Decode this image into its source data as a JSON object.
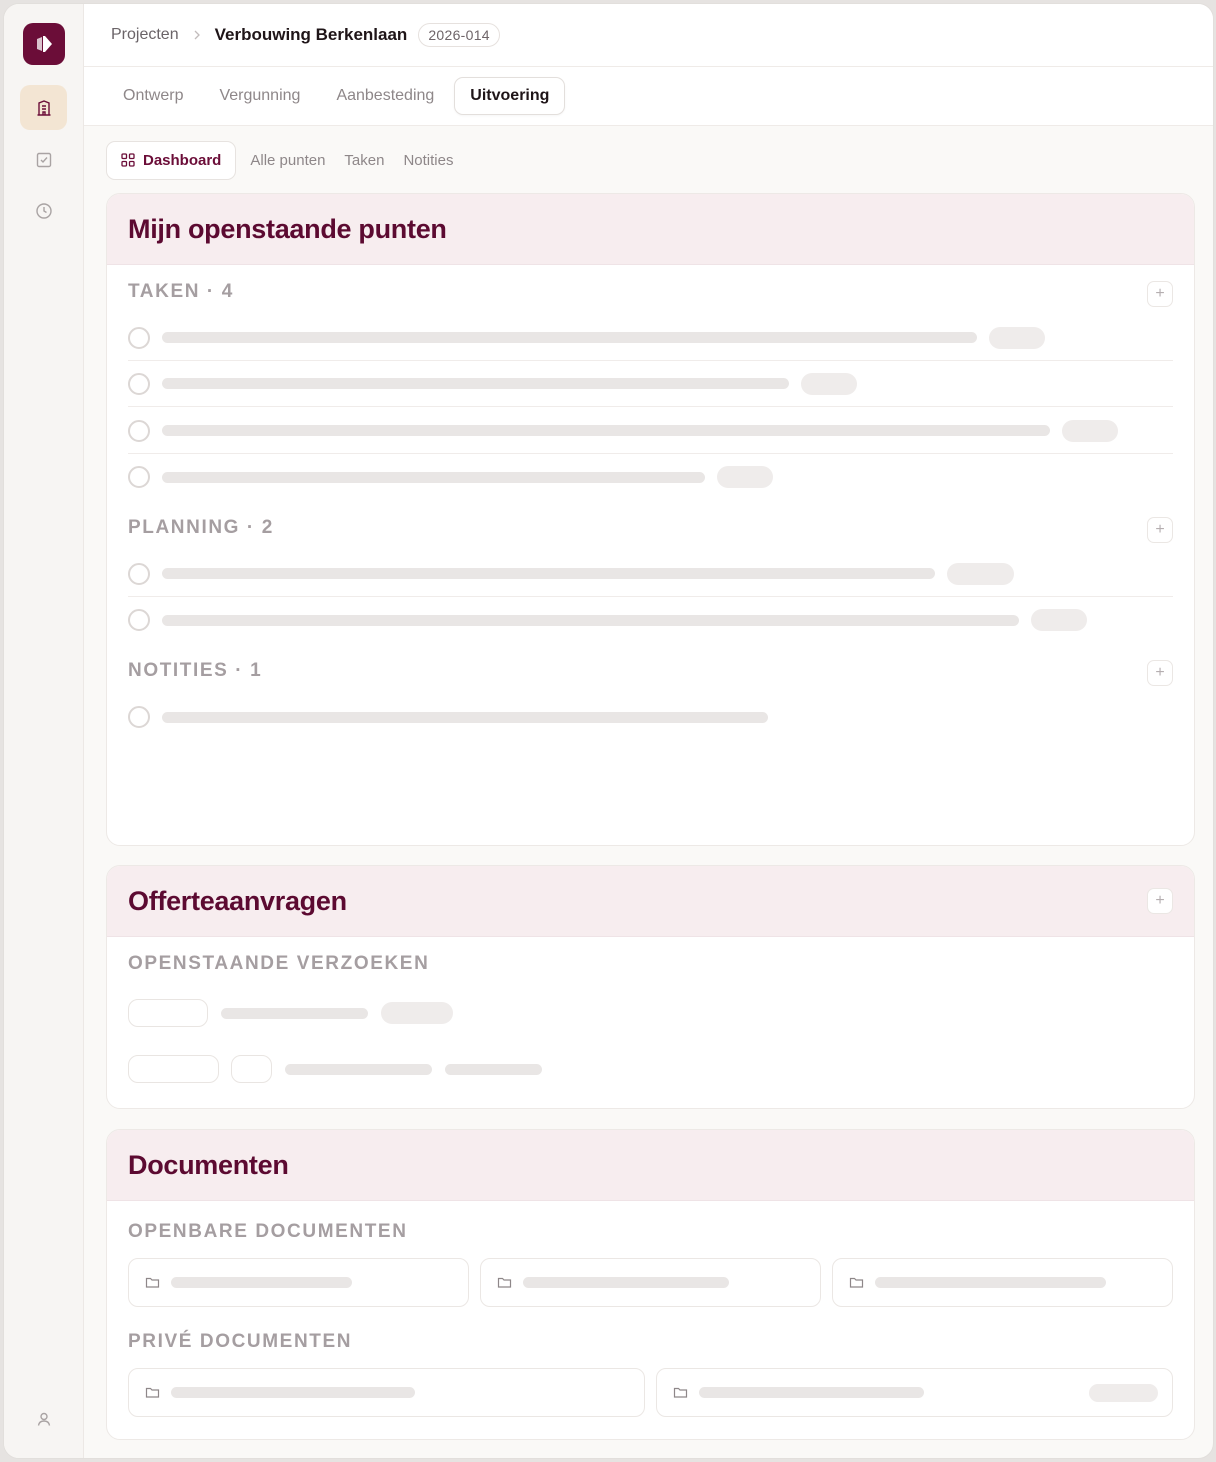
{
  "sidebar": {
    "logo_icon": "brand-logo-icon",
    "items": [
      {
        "icon": "building-icon",
        "active": true
      },
      {
        "icon": "checkbox-icon",
        "active": false
      },
      {
        "icon": "clock-icon",
        "active": false
      }
    ],
    "bottom_icon": "user-icon"
  },
  "breadcrumb": {
    "root": "Projecten",
    "current": "Verbouwing Berkenlaan",
    "code": "2026-014"
  },
  "phases": [
    "Ontwerp",
    "Vergunning",
    "Aanbesteding",
    "Uitvoering"
  ],
  "active_phase": "Uitvoering",
  "subtabs": {
    "dashboard": "Dashboard",
    "all_points": "Alle punten",
    "tasks": "Taken",
    "notes": "Notities"
  },
  "open_points": {
    "title": "Mijn openstaande punten",
    "tasks_label": "TAKEN · 4",
    "planning_label": "PLANNING · 2",
    "notes_label": "NOTITIES · 1"
  },
  "quotes": {
    "title": "Offerteaanvragen",
    "pending_label": "OPENSTAANDE VERZOEKEN"
  },
  "documents": {
    "title": "Documenten",
    "public_label": "OPENBARE DOCUMENTEN",
    "private_label": "PRIVÉ DOCUMENTEN"
  },
  "colors": {
    "brand": "#6b0d38",
    "card_header_bg": "#f7edef",
    "active_nav_bg": "#f3e5d3"
  }
}
